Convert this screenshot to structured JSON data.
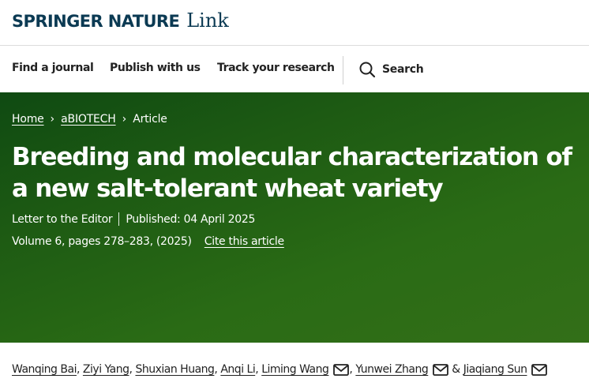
{
  "header": {
    "brand": "SPRINGER NATURE",
    "product": "Link"
  },
  "nav": {
    "items": [
      {
        "label": "Find a journal"
      },
      {
        "label": "Publish with us"
      },
      {
        "label": "Track your research"
      }
    ],
    "search_label": "Search",
    "search_icon": "search-icon"
  },
  "breadcrumb": {
    "home": "Home",
    "journal": "aBIOTECH",
    "current": "Article",
    "separator": "›"
  },
  "article": {
    "title": "Breeding and molecular characterization of a new salt-tolerant wheat variety",
    "type": "Letter to the Editor",
    "published": "Published: 04 April 2025",
    "volume": "Volume 6, pages 278–283, (2025)",
    "cite": "Cite this article"
  },
  "authors": [
    {
      "name": "Wanqing Bai",
      "sep": ",",
      "mail": false
    },
    {
      "name": "Ziyi Yang",
      "sep": ",",
      "mail": false
    },
    {
      "name": "Shuxian Huang",
      "sep": ",",
      "mail": false
    },
    {
      "name": "Anqi Li",
      "sep": ",",
      "mail": false
    },
    {
      "name": "Liming Wang",
      "sep": ",",
      "mail": true
    },
    {
      "name": "Yunwei Zhang",
      "sep": "&",
      "mail": true
    },
    {
      "name": "Jiaqiang Sun",
      "sep": "",
      "mail": true
    }
  ],
  "colors": {
    "brand": "#0b3a53",
    "hero_start": "#0f4a12",
    "hero_end": "#336f18"
  }
}
